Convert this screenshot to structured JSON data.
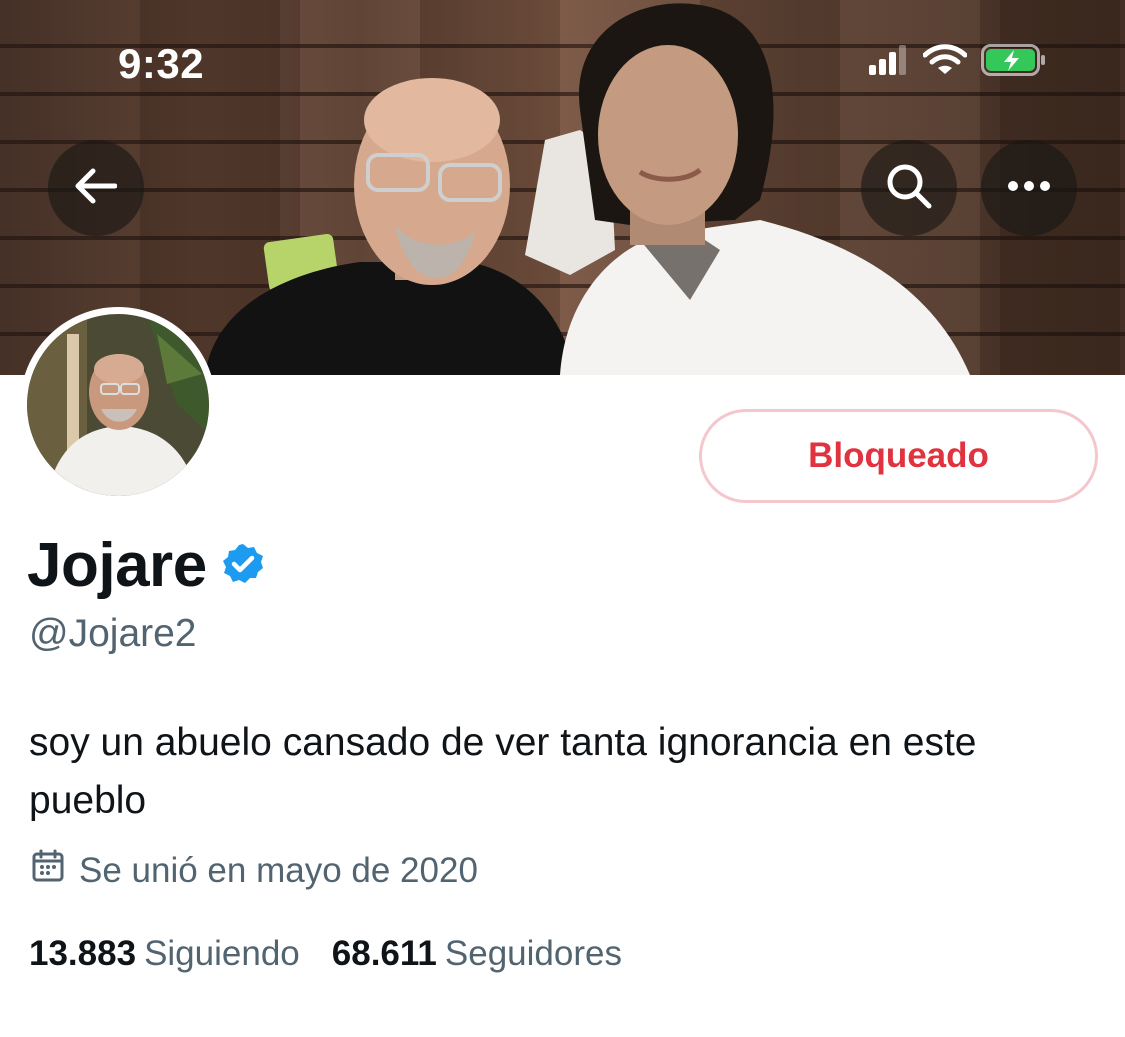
{
  "status_bar": {
    "time": "9:32",
    "icons": [
      "signal-icon",
      "wifi-icon",
      "battery-charging-icon"
    ],
    "battery_color": "#34c759"
  },
  "header": {
    "back_icon": "arrow-left-icon",
    "search_icon": "search-icon",
    "more_icon": "more-icon"
  },
  "profile": {
    "block_button_label": "Bloqueado",
    "display_name": "Jojare",
    "verified_badge_icon": "verified-badge-icon",
    "verified_color": "#1d9bf0",
    "handle": "@Jojare2",
    "bio": "soy un abuelo cansado de ver tanta ignorancia en este pueblo",
    "joined_icon": "calendar-icon",
    "joined": "Se unió en mayo de 2020",
    "following_count": "13.883",
    "following_label": "Siguiendo",
    "followers_count": "68.611",
    "followers_label": "Seguidores"
  },
  "colors": {
    "blocked_text": "#e0323f",
    "blocked_border": "#f4c7cc",
    "secondary_text": "#536471",
    "primary_text": "#0f1419"
  }
}
